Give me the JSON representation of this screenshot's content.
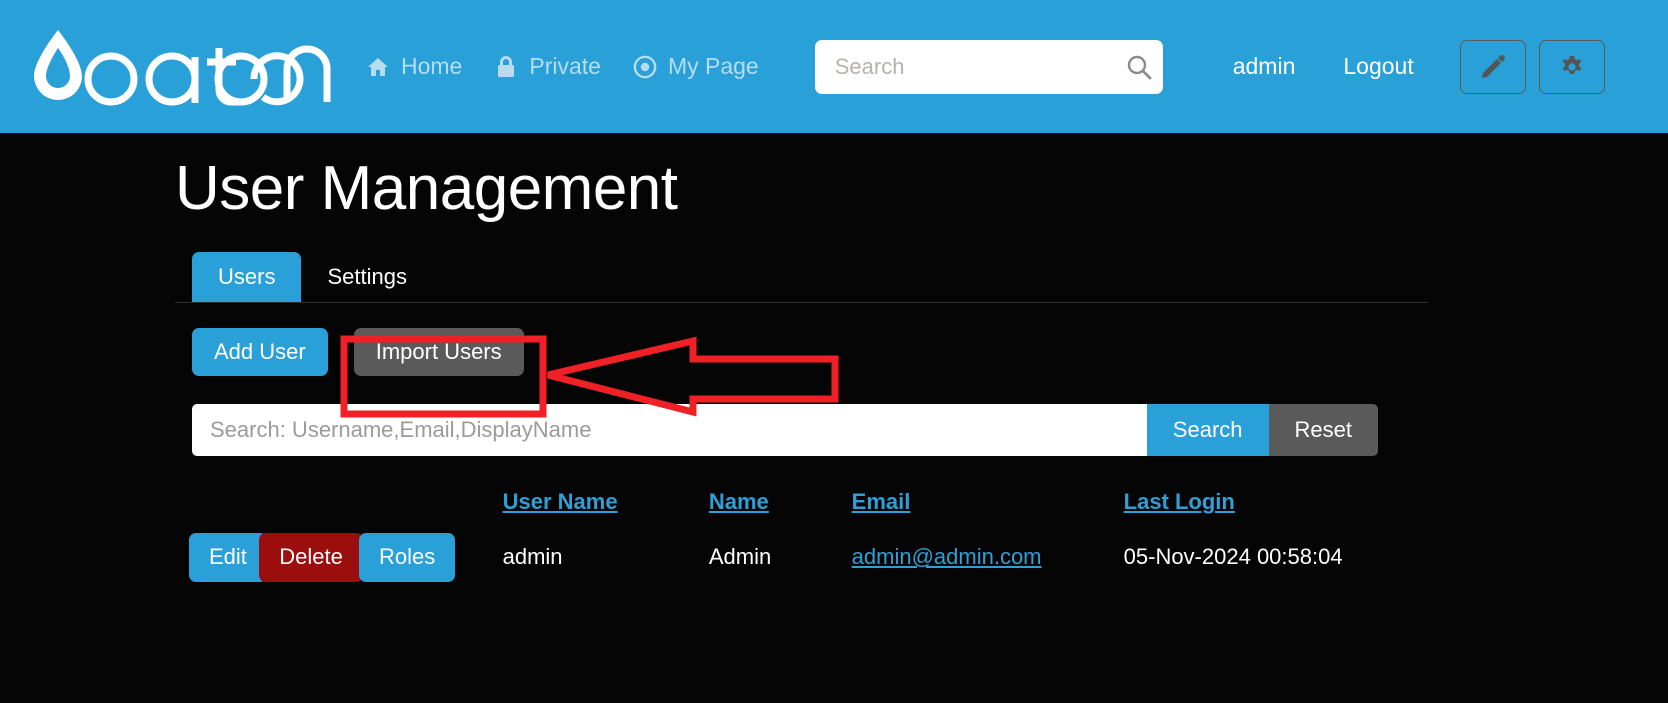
{
  "header": {
    "brand": "oqtane",
    "logo_icon": "water-drop-icon",
    "nav": [
      {
        "label": "Home",
        "icon": "home-icon"
      },
      {
        "label": "Private",
        "icon": "lock-icon"
      },
      {
        "label": "My Page",
        "icon": "target-icon"
      }
    ],
    "search": {
      "placeholder": "Search",
      "value": "",
      "icon": "search-icon"
    },
    "user": "admin",
    "logout": "Logout",
    "edit_icon": "pencil-icon",
    "settings_icon": "gear-icon",
    "bg_color": "#29a0d8"
  },
  "main": {
    "title": "User Management",
    "tabs": [
      {
        "label": "Users",
        "active": true
      },
      {
        "label": "Settings",
        "active": false
      }
    ],
    "toolbar": {
      "add_user": "Add User",
      "import_users": "Import Users"
    },
    "filter": {
      "placeholder": "Search: Username,Email,DisplayName",
      "value": "",
      "search_label": "Search",
      "reset_label": "Reset"
    },
    "table": {
      "headers": [
        "User Name",
        "Name",
        "Email",
        "Last Login"
      ],
      "row_actions": [
        "Edit",
        "Delete",
        "Roles"
      ],
      "rows": [
        {
          "edit": "Edit",
          "delete": "Delete",
          "roles": "Roles",
          "username": "admin",
          "name": "Admin",
          "email": "admin@admin.com",
          "last_login": "05-Nov-2024 00:58:04"
        }
      ]
    }
  },
  "annotation": {
    "type": "red-arrow-highlight",
    "color": "#f02027",
    "target": "Import Users"
  }
}
